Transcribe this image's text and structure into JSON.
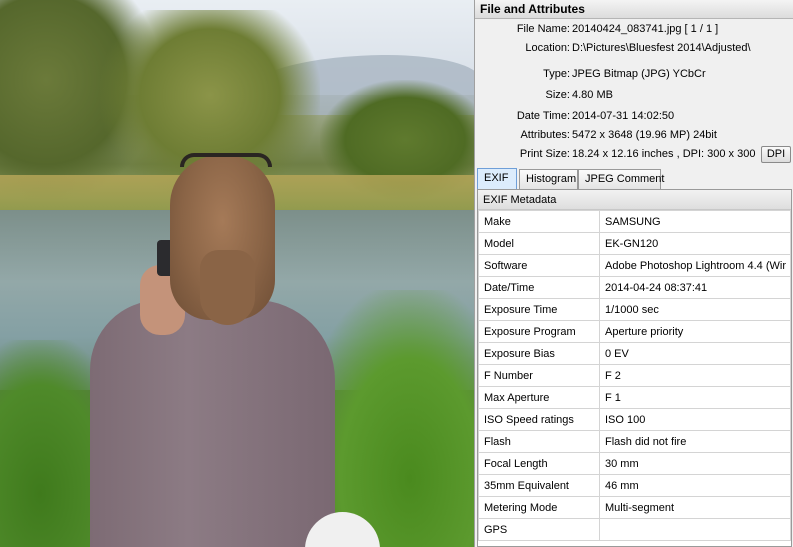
{
  "panel": {
    "title": "File and Attributes",
    "attributes": [
      {
        "key": "File Name:",
        "value": "20140424_083741.jpg   [ 1 / 1 ]"
      },
      {
        "key": "Location:",
        "value": "D:\\Pictures\\Bluesfest 2014\\Adjusted\\"
      },
      {
        "key": "Type:",
        "value": "JPEG Bitmap (JPG) YCbCr"
      },
      {
        "key": "Size:",
        "value": "4.80 MB"
      },
      {
        "key": "Date Time:",
        "value": "2014-07-31 14:02:50"
      },
      {
        "key": "Attributes:",
        "value": "5472 x 3648 (19.96 MP)  24bit"
      },
      {
        "key": "Print Size:",
        "value": "18.24 x 12.16 inches ,  DPI: 300 x 300"
      }
    ],
    "dpi_button": "DPI",
    "tabs": [
      "EXIF",
      "Histogram",
      "JPEG Comment"
    ],
    "active_tab": "EXIF",
    "exif_title": "EXIF Metadata",
    "exif_rows": [
      {
        "key": "Make",
        "value": "SAMSUNG"
      },
      {
        "key": "Model",
        "value": "EK-GN120"
      },
      {
        "key": "Software",
        "value": "Adobe Photoshop Lightroom 4.4 (Wir"
      },
      {
        "key": "Date/Time",
        "value": "2014-04-24 08:37:41"
      },
      {
        "key": "Exposure Time",
        "value": "1/1000 sec"
      },
      {
        "key": "Exposure Program",
        "value": "Aperture priority"
      },
      {
        "key": "Exposure Bias",
        "value": "0 EV"
      },
      {
        "key": "F Number",
        "value": "F 2"
      },
      {
        "key": "Max Aperture",
        "value": "F 1"
      },
      {
        "key": "ISO Speed ratings",
        "value": "ISO 100"
      },
      {
        "key": "Flash",
        "value": "Flash did not fire"
      },
      {
        "key": "Focal Length",
        "value": "30 mm"
      },
      {
        "key": "35mm Equivalent",
        "value": "46 mm"
      },
      {
        "key": "Metering Mode",
        "value": "Multi-segment"
      },
      {
        "key": "GPS",
        "value": ""
      }
    ]
  }
}
